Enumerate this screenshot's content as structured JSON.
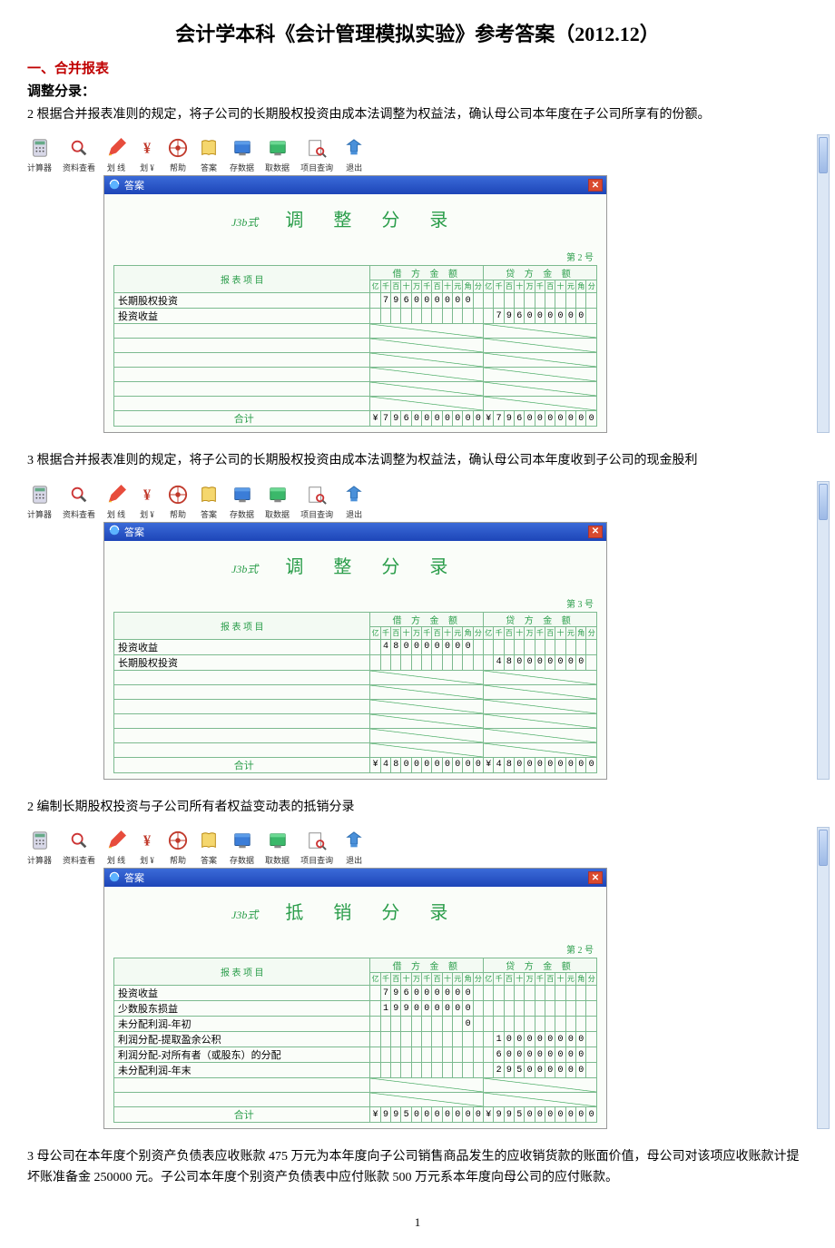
{
  "title": "会计学本科《会计管理模拟实验》参考答案（2012.12）",
  "section1_header": "一、合并报表",
  "subheader_adjust": "调整分录：",
  "para2": "2 根据合并报表准则的规定，将子公司的长期股权投资由成本法调整为权益法，确认母公司本年度在子公司所享有的份额。",
  "para3": "3 根据合并报表准则的规定，将子公司的长期股权投资由成本法调整为权益法，确认母公司本年度收到子公司的现金股利",
  "para_offset2": "2 编制长期股权投资与子公司所有者权益变动表的抵销分录",
  "para_mother": "3 母公司在本年度个别资产负债表应收账款 475 万元为本年度向子公司销售商品发生的应收销货款的账面价值，母公司对该项应收账款计提坏账准备金 250000 元。子公司本年度个别资产负债表中应付账款 500 万元系本年度向母公司的应付账款。",
  "page_number": "1",
  "toolbar": [
    {
      "label": "计算器",
      "icon": "calc"
    },
    {
      "label": "资料查看",
      "icon": "search"
    },
    {
      "label": "划 线",
      "icon": "pencil"
    },
    {
      "label": "划 ¥",
      "icon": "yen"
    },
    {
      "label": "帮助",
      "icon": "help"
    },
    {
      "label": "答案",
      "icon": "book"
    },
    {
      "label": "存数据",
      "icon": "save"
    },
    {
      "label": "取数据",
      "icon": "load"
    },
    {
      "label": "项目查询",
      "icon": "find"
    },
    {
      "label": "退出",
      "icon": "exit"
    }
  ],
  "windows": {
    "bar_title": "答案",
    "form_code": "J3b式",
    "col_item_header": "报 表 项 目",
    "debit_header": "借 方 金 额",
    "credit_header": "贷 方 金 额",
    "units": [
      "亿",
      "千",
      "百",
      "十",
      "万",
      "千",
      "百",
      "十",
      "元",
      "角",
      "分"
    ],
    "total_label": "合计",
    "yen": "¥"
  },
  "entries": [
    {
      "title": "调 整 分 录",
      "page_no": "第 2 号",
      "rows": [
        {
          "item": "长期股权投资",
          "debit": [
            "",
            "7",
            "9",
            "6",
            "0",
            "0",
            "0",
            "0",
            "0",
            "0",
            ""
          ],
          "credit": [
            "",
            "",
            "",
            "",
            "",
            "",
            "",
            "",
            "",
            "",
            ""
          ]
        },
        {
          "item": "投资收益",
          "debit": [
            "",
            "",
            "",
            "",
            "",
            "",
            "",
            "",
            "",
            "",
            ""
          ],
          "credit": [
            "",
            "7",
            "9",
            "6",
            "0",
            "0",
            "0",
            "0",
            "0",
            "0",
            ""
          ]
        }
      ],
      "blank_rows": 6,
      "total_debit": [
        "¥",
        "7",
        "9",
        "6",
        "0",
        "0",
        "0",
        "0",
        "0",
        "0",
        "0"
      ],
      "total_credit": [
        "¥",
        "7",
        "9",
        "6",
        "0",
        "0",
        "0",
        "0",
        "0",
        "0",
        "0"
      ]
    },
    {
      "title": "调 整 分 录",
      "page_no": "第 3 号",
      "rows": [
        {
          "item": "投资收益",
          "debit": [
            "",
            "4",
            "8",
            "0",
            "0",
            "0",
            "0",
            "0",
            "0",
            "0",
            ""
          ],
          "credit": [
            "",
            "",
            "",
            "",
            "",
            "",
            "",
            "",
            "",
            "",
            ""
          ]
        },
        {
          "item": "长期股权投资",
          "debit": [
            "",
            "",
            "",
            "",
            "",
            "",
            "",
            "",
            "",
            "",
            ""
          ],
          "credit": [
            "",
            "4",
            "8",
            "0",
            "0",
            "0",
            "0",
            "0",
            "0",
            "0",
            ""
          ]
        }
      ],
      "blank_rows": 6,
      "total_debit": [
        "¥",
        "4",
        "8",
        "0",
        "0",
        "0",
        "0",
        "0",
        "0",
        "0",
        "0"
      ],
      "total_credit": [
        "¥",
        "4",
        "8",
        "0",
        "0",
        "0",
        "0",
        "0",
        "0",
        "0",
        "0"
      ]
    },
    {
      "title": "抵 销 分 录",
      "page_no": "第 2 号",
      "rows": [
        {
          "item": "投资收益",
          "debit": [
            "",
            "7",
            "9",
            "6",
            "0",
            "0",
            "0",
            "0",
            "0",
            "0",
            ""
          ],
          "credit": [
            "",
            "",
            "",
            "",
            "",
            "",
            "",
            "",
            "",
            "",
            ""
          ]
        },
        {
          "item": "少数股东损益",
          "debit": [
            "",
            "1",
            "9",
            "9",
            "0",
            "0",
            "0",
            "0",
            "0",
            "0",
            ""
          ],
          "credit": [
            "",
            "",
            "",
            "",
            "",
            "",
            "",
            "",
            "",
            "",
            ""
          ]
        },
        {
          "item": "未分配利润-年初",
          "debit": [
            "",
            "",
            "",
            "",
            "",
            "",
            "",
            "",
            "",
            "0",
            ""
          ],
          "credit": [
            "",
            "",
            "",
            "",
            "",
            "",
            "",
            "",
            "",
            "",
            ""
          ]
        },
        {
          "item": "利润分配-提取盈余公积",
          "debit": [
            "",
            "",
            "",
            "",
            "",
            "",
            "",
            "",
            "",
            "",
            ""
          ],
          "credit": [
            "",
            "1",
            "0",
            "0",
            "0",
            "0",
            "0",
            "0",
            "0",
            "0",
            ""
          ]
        },
        {
          "item": "利润分配-对所有者（或股东）的分配",
          "debit": [
            "",
            "",
            "",
            "",
            "",
            "",
            "",
            "",
            "",
            "",
            ""
          ],
          "credit": [
            "",
            "6",
            "0",
            "0",
            "0",
            "0",
            "0",
            "0",
            "0",
            "0",
            ""
          ]
        },
        {
          "item": "未分配利润-年末",
          "debit": [
            "",
            "",
            "",
            "",
            "",
            "",
            "",
            "",
            "",
            "",
            ""
          ],
          "credit": [
            "",
            "2",
            "9",
            "5",
            "0",
            "0",
            "0",
            "0",
            "0",
            "0",
            ""
          ]
        }
      ],
      "blank_rows": 2,
      "total_debit": [
        "¥",
        "9",
        "9",
        "5",
        "0",
        "0",
        "0",
        "0",
        "0",
        "0",
        "0"
      ],
      "total_credit": [
        "¥",
        "9",
        "9",
        "5",
        "0",
        "0",
        "0",
        "0",
        "0",
        "0",
        "0"
      ]
    }
  ]
}
